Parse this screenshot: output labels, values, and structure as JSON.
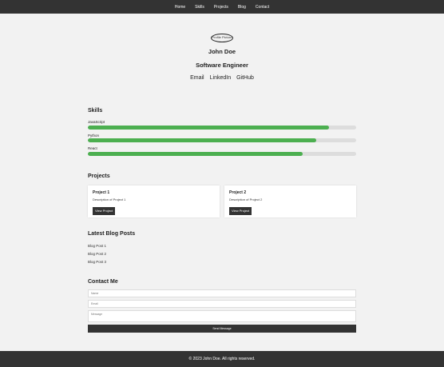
{
  "nav": {
    "items": [
      {
        "label": "Home"
      },
      {
        "label": "Skills"
      },
      {
        "label": "Projects"
      },
      {
        "label": "Blog"
      },
      {
        "label": "Contact"
      }
    ]
  },
  "hero": {
    "avatar_alt": "Profile Picture",
    "name": "John Doe",
    "role": "Software Engineer",
    "links": [
      {
        "label": "Email"
      },
      {
        "label": "LinkedIn"
      },
      {
        "label": "GitHub"
      }
    ]
  },
  "skills": {
    "title": "Skills",
    "items": [
      {
        "label": "JavaScript",
        "percent": 90
      },
      {
        "label": "Python",
        "percent": 85
      },
      {
        "label": "React",
        "percent": 80
      }
    ],
    "bar_color": "#4caf50"
  },
  "projects": {
    "title": "Projects",
    "items": [
      {
        "title": "Project 1",
        "description": "Description of Project 1",
        "button": "View Project"
      },
      {
        "title": "Project 2",
        "description": "Description of Project 2",
        "button": "View Project"
      }
    ]
  },
  "blog": {
    "title": "Latest Blog Posts",
    "posts": [
      "Blog Post 1",
      "Blog Post 2",
      "Blog Post 3"
    ]
  },
  "contact": {
    "title": "Contact Me",
    "name_placeholder": "Name",
    "email_placeholder": "Email",
    "message_placeholder": "Message",
    "send_label": "Send Message"
  },
  "footer": {
    "text": "© 2023 John Doe. All rights reserved."
  }
}
